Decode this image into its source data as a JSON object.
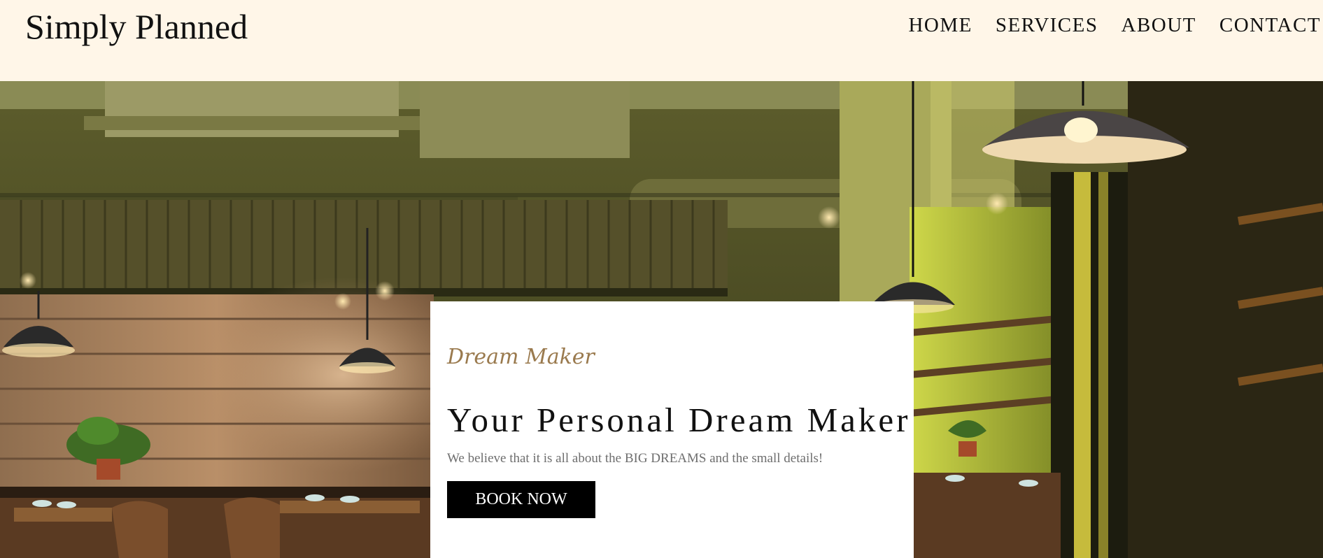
{
  "header": {
    "brand": "Simply Planned",
    "nav": [
      "HOME",
      "SERVICES",
      "ABOUT",
      "CONTACT"
    ]
  },
  "hero": {
    "image_subject": "restaurant interior with pendant lamps",
    "script_title": "Dream Maker",
    "title": "Your Personal Dream Maker",
    "text": "We believe that it is all about the BIG DREAMS and the small details!",
    "button_label": "BOOK NOW"
  },
  "colors": {
    "header_background": "#fff6e8",
    "accent_script": "#9a7a4e",
    "button_background": "#000000",
    "button_text": "#ffffff"
  }
}
